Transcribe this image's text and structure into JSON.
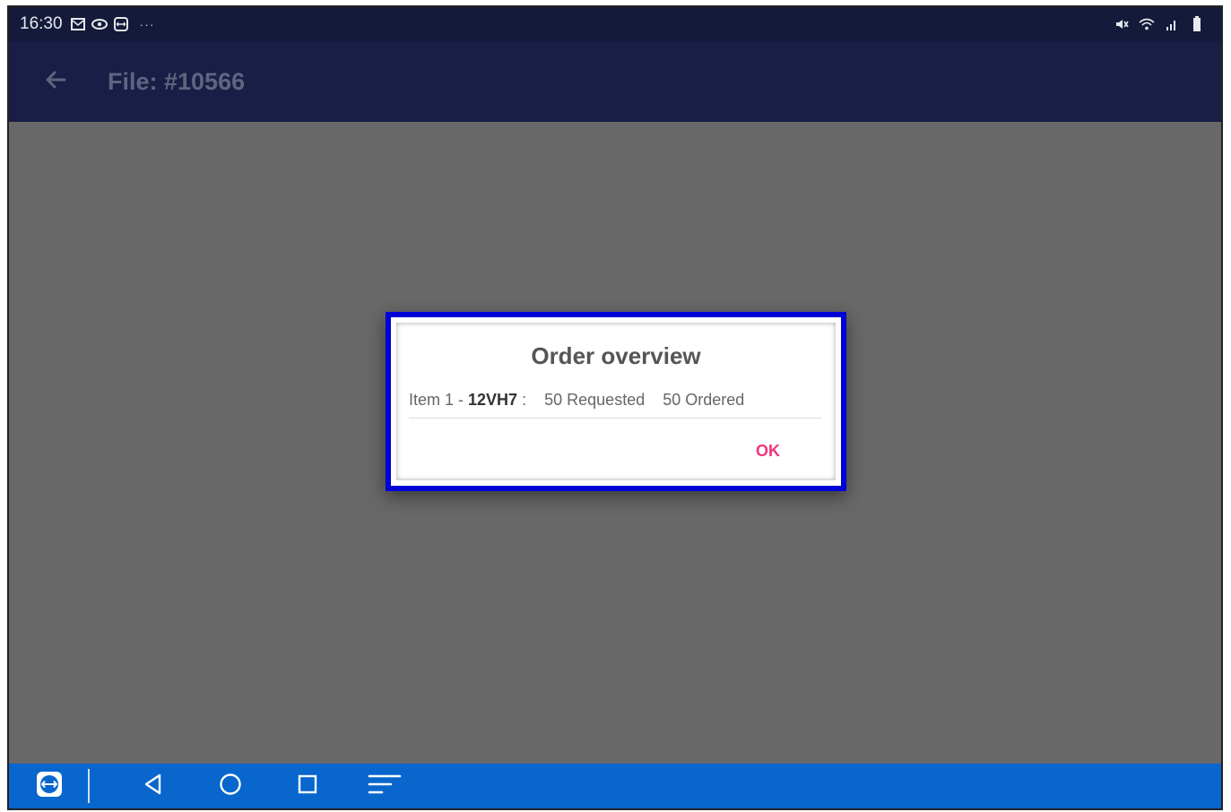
{
  "statusbar": {
    "time": "16:30",
    "left_icons": [
      "gmail-icon",
      "eye-icon",
      "teamviewer-icon"
    ],
    "more": "···",
    "right_icons": [
      "mute-icon",
      "wifi-icon",
      "signal-icon",
      "battery-icon"
    ]
  },
  "appbar": {
    "back_icon": "arrow-left-icon",
    "title": "File: #10566"
  },
  "dialog": {
    "title": "Order overview",
    "item": {
      "prefix": "Item 1 -",
      "code": "12VH7",
      "separator": ":",
      "requested": "50 Requested",
      "ordered": "50 Ordered"
    },
    "ok_label": "OK"
  },
  "navbar": {
    "icons": [
      "teamviewer-icon",
      "back-triangle-icon",
      "home-circle-icon",
      "recents-square-icon",
      "menu-lines-icon"
    ]
  },
  "colors": {
    "statusbar_bg": "#141a3a",
    "appbar_bg": "#181e45",
    "scrim": "#686868",
    "dialog_border": "#0000d8",
    "ok_accent": "#f0347a",
    "navbar_bg": "#0866cc"
  }
}
